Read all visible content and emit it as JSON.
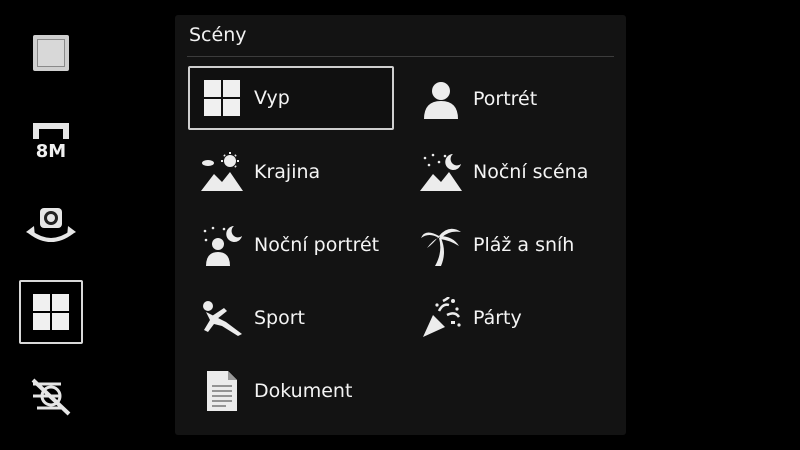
{
  "sidebar": {
    "items": [
      {
        "name": "flash-mode",
        "icon": "square-frame-icon"
      },
      {
        "name": "resolution",
        "icon": "resolution-icon",
        "text": "8M"
      },
      {
        "name": "switch-camera",
        "icon": "rotate-camera-icon"
      },
      {
        "name": "scene-mode",
        "icon": "grid-icon",
        "active": true
      },
      {
        "name": "shutter-sound",
        "icon": "sound-off-icon"
      }
    ]
  },
  "panel": {
    "title": "Scény",
    "options": [
      {
        "label": "Vyp",
        "icon": "grid-icon",
        "selected": true
      },
      {
        "label": "Portrét",
        "icon": "person-icon"
      },
      {
        "label": "Krajina",
        "icon": "landscape-icon"
      },
      {
        "label": "Noční scéna",
        "icon": "night-scene-icon"
      },
      {
        "label": "Noční portrét",
        "icon": "night-portrait-icon"
      },
      {
        "label": "Pláž a sníh",
        "icon": "palm-tree-icon"
      },
      {
        "label": "Sport",
        "icon": "sport-icon"
      },
      {
        "label": "Párty",
        "icon": "party-icon"
      },
      {
        "label": "Dokument",
        "icon": "document-icon"
      }
    ]
  },
  "colors": {
    "background": "#000000",
    "panel": "#131313",
    "text": "#f4f4f4",
    "selection_border": "#cfcfcf"
  }
}
